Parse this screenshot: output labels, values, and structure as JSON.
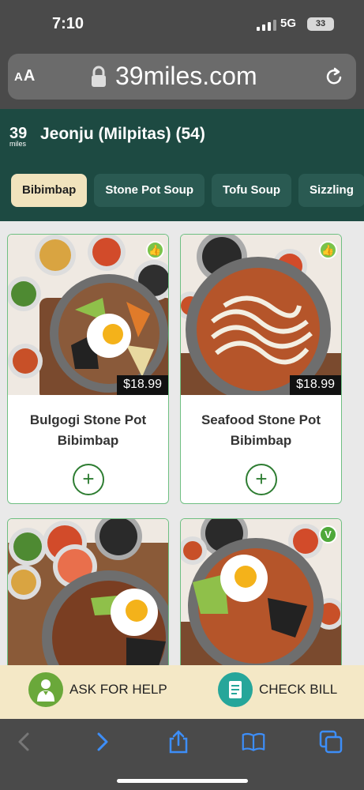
{
  "status_bar": {
    "time": "7:10",
    "network": "5G",
    "battery": "33"
  },
  "browser": {
    "text_size_label": "AA",
    "url": "39miles.com"
  },
  "restaurant": {
    "logo_number": "39",
    "logo_word": "miles",
    "title": "Jeonju (Milpitas) (54)"
  },
  "tabs": [
    {
      "label": "Bibimbap"
    },
    {
      "label": "Stone Pot Soup"
    },
    {
      "label": "Tofu Soup"
    },
    {
      "label": "Sizzling"
    }
  ],
  "menu_items": [
    {
      "name": "Bulgogi Stone Pot Bibimbap",
      "price": "$18.99",
      "badge": "thumbs-up-icon"
    },
    {
      "name": "Seafood Stone Pot Bibimbap",
      "price": "$18.99",
      "badge": "thumbs-up-icon"
    },
    {
      "name": "",
      "price": "",
      "badge": ""
    },
    {
      "name": "",
      "price": "",
      "badge": "V"
    }
  ],
  "help_bar": {
    "ask_label": "ASK FOR HELP",
    "bill_label": "CHECK BILL"
  },
  "colors": {
    "header_bg": "#1d4a42",
    "active_tab": "#f1e3bd",
    "accent_green": "#2e7d32",
    "help_bar_bg": "#f4e8c6"
  }
}
